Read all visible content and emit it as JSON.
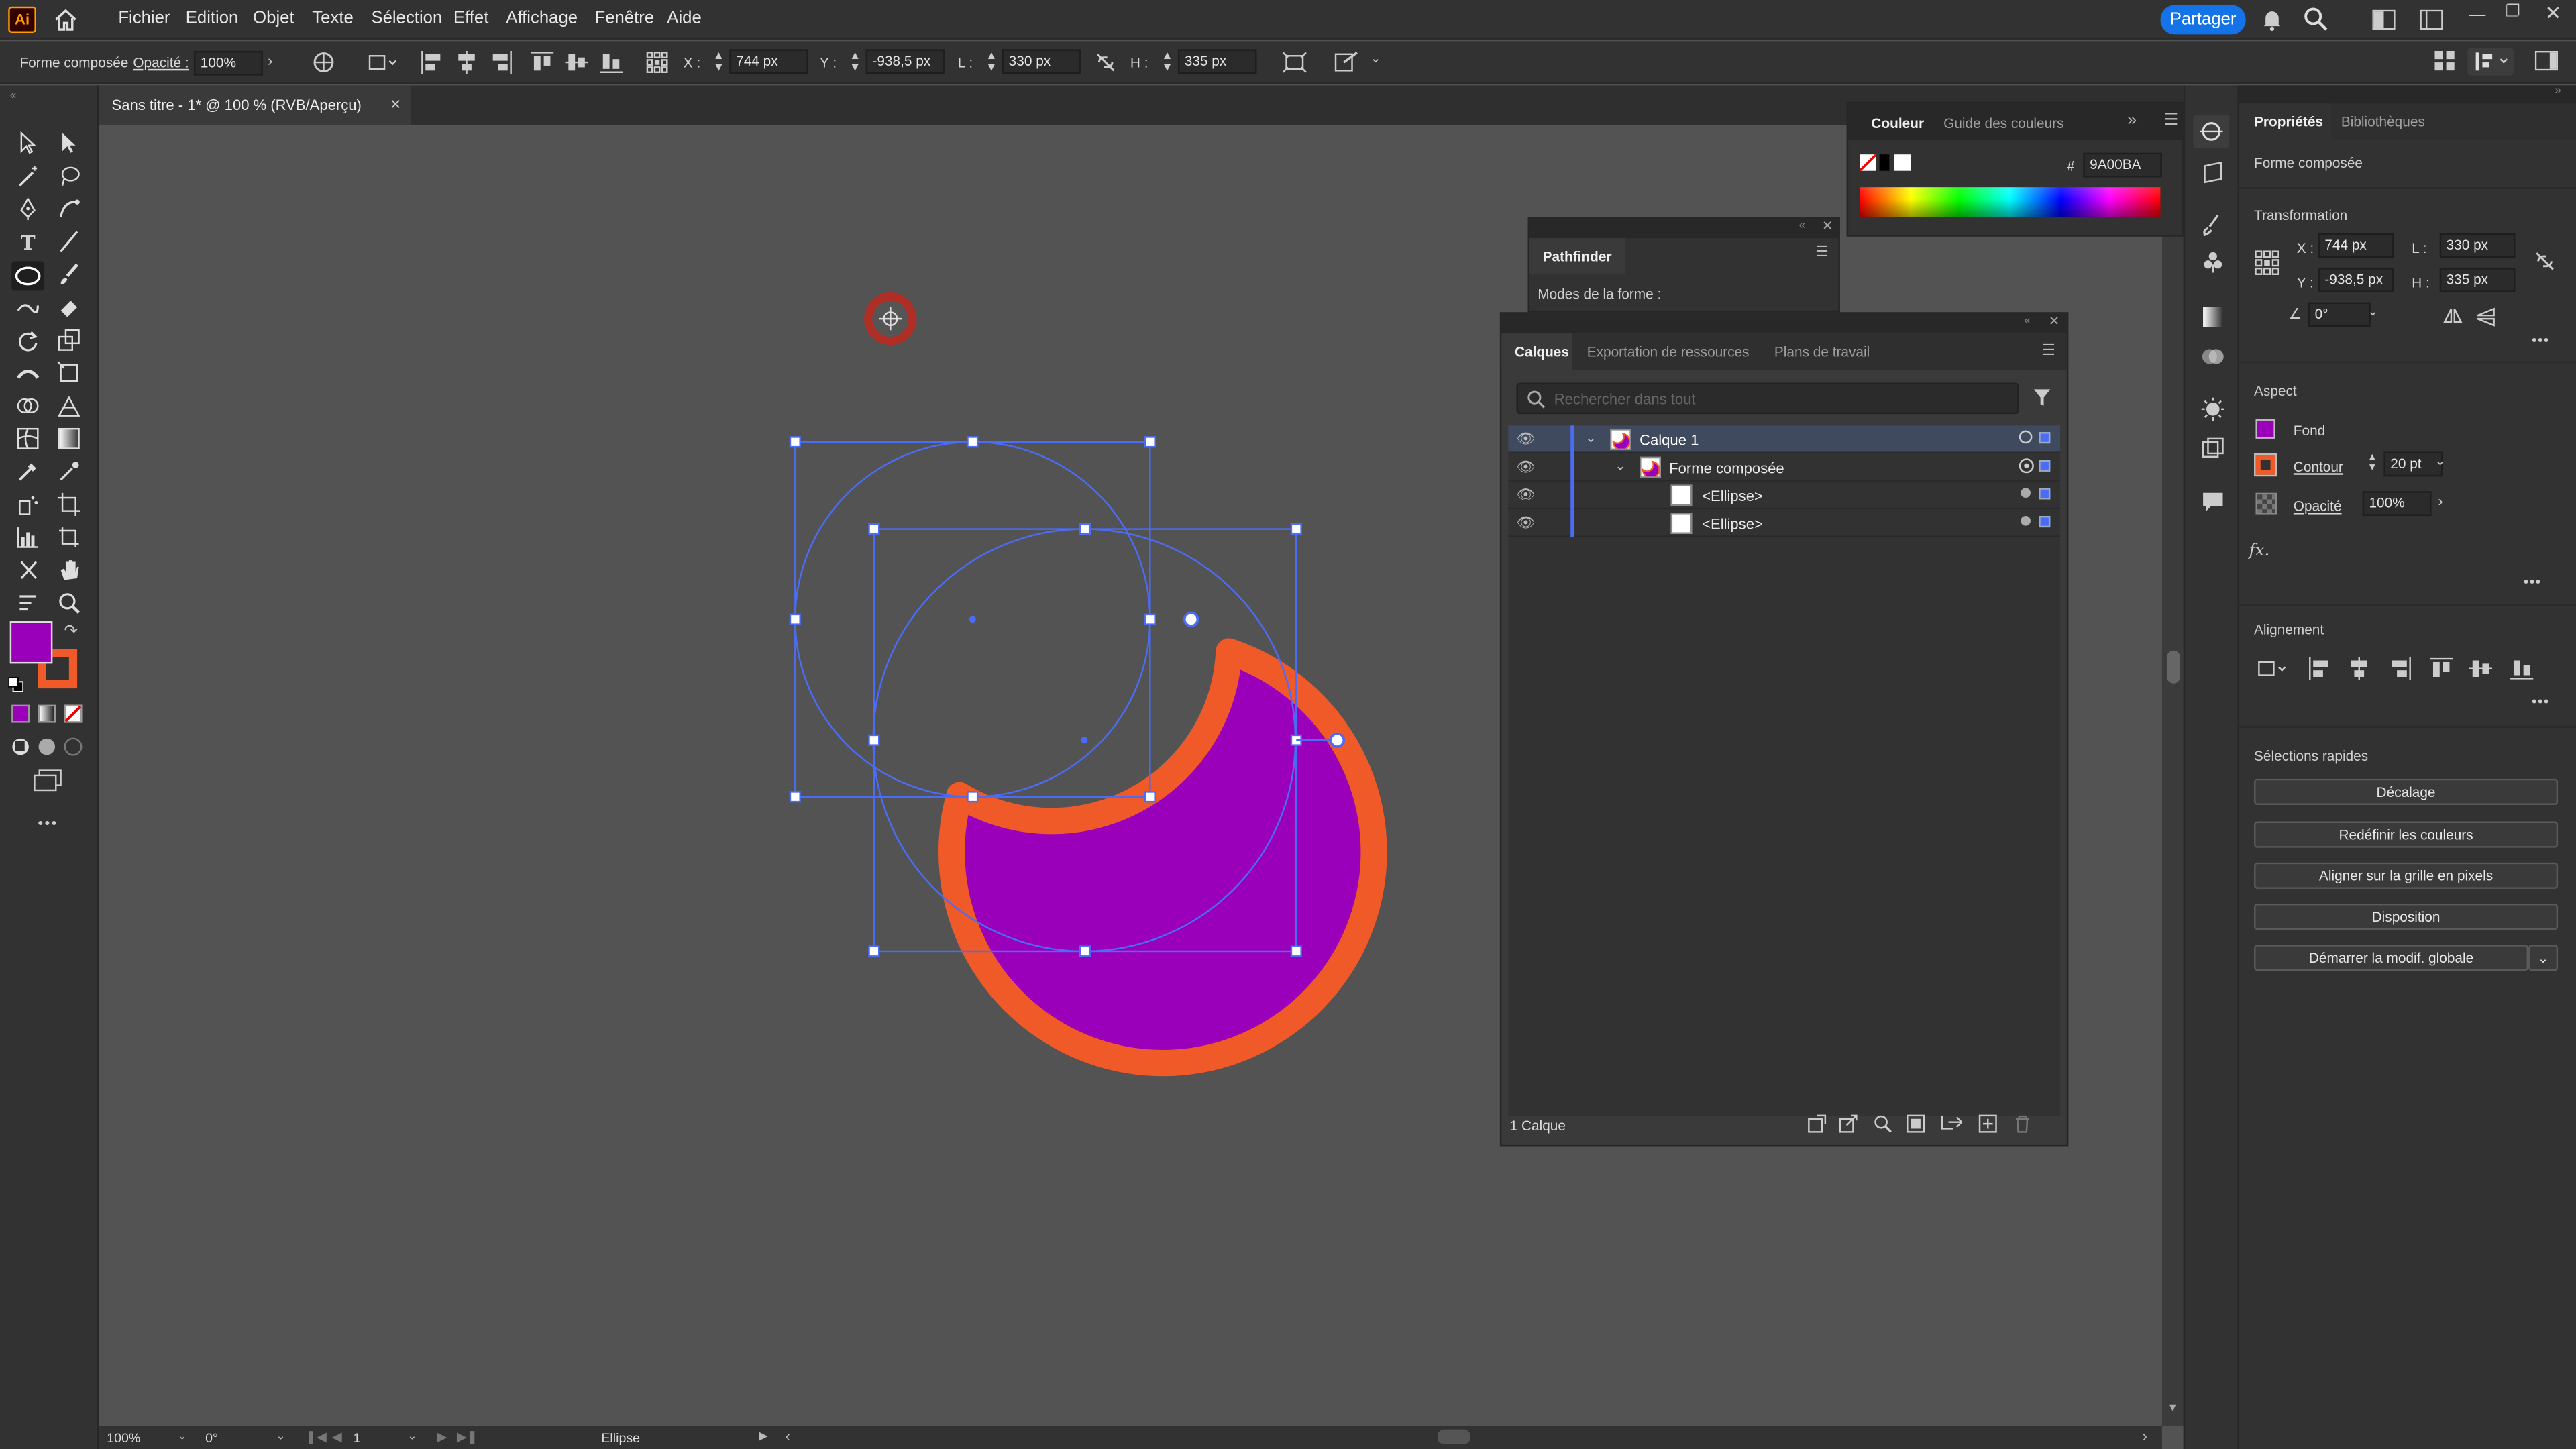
{
  "menubar": {
    "logo": "Ai",
    "items": [
      "Fichier",
      "Edition",
      "Objet",
      "Texte",
      "Sélection",
      "Effet",
      "Affichage",
      "Fenêtre",
      "Aide"
    ],
    "share_label": "Partager"
  },
  "control_bar": {
    "selection_type": "Forme composée",
    "opacity_label": "Opacité :",
    "opacity_value": "100%",
    "x_label": "X :",
    "x_value": "744 px",
    "y_label": "Y :",
    "y_value": "-938,5 px",
    "w_label": "L :",
    "w_value": "330 px",
    "h_label": "H :",
    "h_value": "335 px"
  },
  "document": {
    "tab_title": "Sans titre - 1* @ 100 % (RVB/Aperçu)",
    "close_glyph": "×"
  },
  "toolbox": {
    "fill_color": "#9A00BA",
    "stroke_color": "#F05A28",
    "more_glyph": "•••"
  },
  "color_panel": {
    "tabs": [
      "Couleur",
      "Guide des couleurs"
    ],
    "hex_label": "#",
    "hex_value": "9A00BA"
  },
  "pathfinder_panel": {
    "title": "Pathfinder",
    "modes_label": "Modes de la forme :"
  },
  "layers_panel": {
    "tabs": [
      "Calques",
      "Exportation de ressources",
      "Plans de travail"
    ],
    "search_placeholder": "Rechercher dans tout",
    "rows": [
      {
        "name": "Calque 1"
      },
      {
        "name": "Forme composée"
      },
      {
        "name": "<Ellipse>"
      },
      {
        "name": "<Ellipse>"
      }
    ],
    "footer_count": "1 Calque"
  },
  "properties_panel": {
    "tabs": [
      "Propriétés",
      "Bibliothèques"
    ],
    "selection_type": "Forme composée",
    "transform_title": "Transformation",
    "x_label": "X :",
    "x_value": "744 px",
    "y_label": "Y :",
    "y_value": "-938,5 px",
    "w_label": "L :",
    "w_value": "330 px",
    "h_label": "H :",
    "h_value": "335 px",
    "angle_value": "0°",
    "aspect_title": "Aspect",
    "fill_label": "Fond",
    "stroke_label": "Contour",
    "stroke_weight": "20 pt",
    "opacity_label": "Opacité",
    "opacity_value": "100%",
    "fx_label": "fx.",
    "align_title": "Alignement",
    "quick_title": "Sélections rapides",
    "quick_buttons": [
      "Décalage",
      "Redéfinir les couleurs",
      "Aligner sur la grille en pixels",
      "Disposition",
      "Démarrer la modif. globale"
    ],
    "more_glyph": "•••"
  },
  "statusbar": {
    "zoom": "100%",
    "rotation": "0°",
    "artboard": "1",
    "tool_name": "Ellipse"
  },
  "colors": {
    "fill": "#9A00BA",
    "stroke": "#F05A28",
    "selection": "#4a6cf7",
    "accent": "#1473e6"
  }
}
